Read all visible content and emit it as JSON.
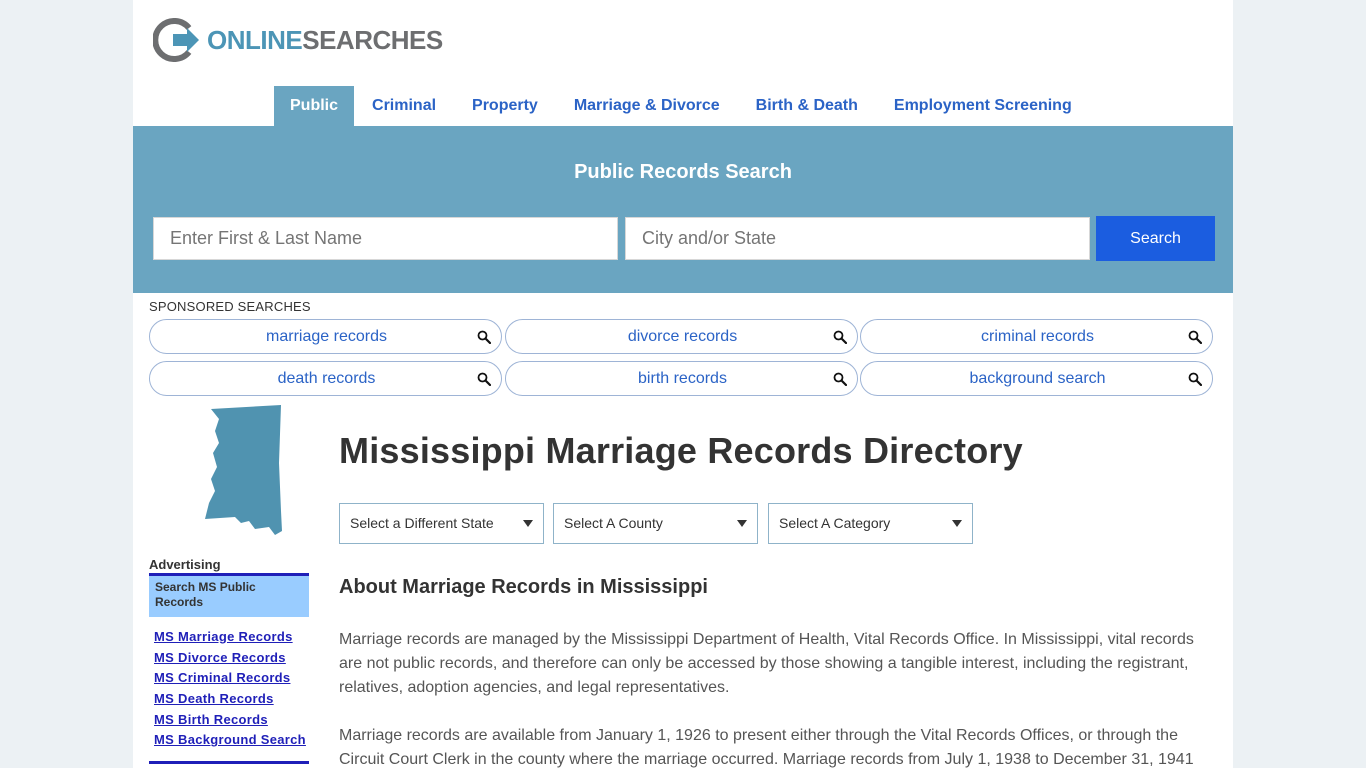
{
  "logo": {
    "part1": "ONLINE",
    "part2": "SEARCHES"
  },
  "nav": [
    {
      "label": "Public",
      "active": true
    },
    {
      "label": "Criminal"
    },
    {
      "label": "Property"
    },
    {
      "label": "Marriage & Divorce"
    },
    {
      "label": "Birth & Death"
    },
    {
      "label": "Employment Screening"
    }
  ],
  "search": {
    "title": "Public Records Search",
    "name_placeholder": "Enter First & Last Name",
    "city_placeholder": "City and/or State",
    "button": "Search"
  },
  "sponsored": {
    "label": "SPONSORED SEARCHES",
    "items": [
      "marriage records",
      "divorce records",
      "criminal records",
      "death records",
      "birth records",
      "background search"
    ]
  },
  "sidebar": {
    "advertising": "Advertising",
    "box_title": "Search MS Public Records",
    "links": [
      "MS Marriage Records",
      "MS Divorce Records",
      "MS Criminal Records",
      "MS Death Records",
      "MS Birth Records",
      "MS Background Search"
    ]
  },
  "main": {
    "title": "Mississippi Marriage Records Directory",
    "selects": [
      "Select a Different State",
      "Select A County",
      "Select A Category"
    ],
    "subtitle": "About Marriage Records in Mississippi",
    "paragraphs": [
      "Marriage records are managed by the Mississippi Department of Health, Vital Records Office. In Mississippi, vital records are not public records, and therefore can only be accessed by those showing a tangible interest, including the registrant, relatives, adoption agencies, and legal representatives.",
      "Marriage records are available from January 1, 1926 to present either through the Vital Records Offices, or through the Circuit Court Clerk in the county where the marriage occurred. Marriage records from July 1, 1938 to December 31, 1941"
    ]
  },
  "colors": {
    "accent": "#6aa5c1",
    "link": "#2b63c6",
    "button": "#1b5de0",
    "sidebar_link": "#1f1fb8"
  },
  "icons": {
    "logo": "arrow-circle-logo-icon",
    "pill": "search-icon",
    "select": "caret-down-icon",
    "map": "mississippi-state-map-icon"
  }
}
